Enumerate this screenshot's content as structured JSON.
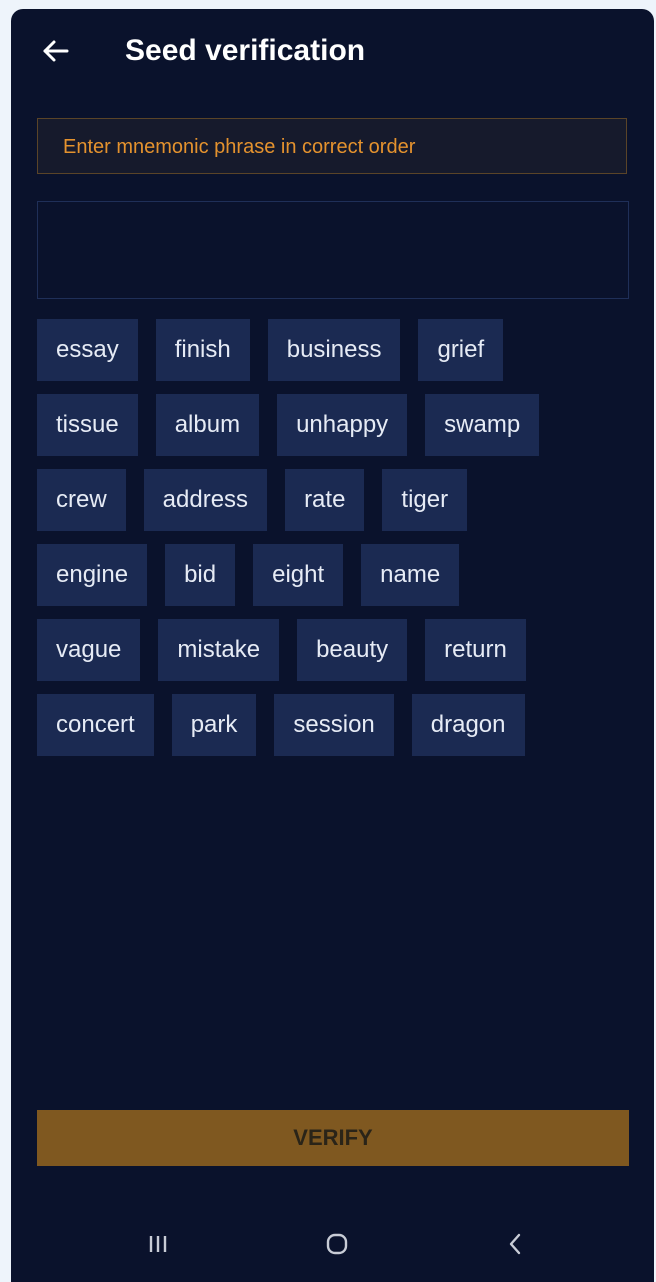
{
  "header": {
    "title": "Seed verification",
    "back_icon": "arrow-left-icon"
  },
  "hint": {
    "text": "Enter mnemonic phrase in correct order"
  },
  "answer": {
    "value": ""
  },
  "words": [
    [
      "essay",
      "finish",
      "business",
      "grief"
    ],
    [
      "tissue",
      "album",
      "unhappy",
      "swamp"
    ],
    [
      "crew",
      "address",
      "rate",
      "tiger"
    ],
    [
      "engine",
      "bid",
      "eight",
      "name"
    ],
    [
      "vague",
      "mistake",
      "beauty",
      "return"
    ],
    [
      "concert",
      "park",
      "session",
      "dragon"
    ]
  ],
  "verify": {
    "label": "VERIFY"
  },
  "navbar": {
    "items": [
      "recent-apps-icon",
      "home-icon",
      "back-icon"
    ]
  },
  "colors": {
    "background": "#0a122c",
    "chip": "#1b2a52",
    "accent": "#e4922e",
    "verify_button": "#7f5820"
  }
}
